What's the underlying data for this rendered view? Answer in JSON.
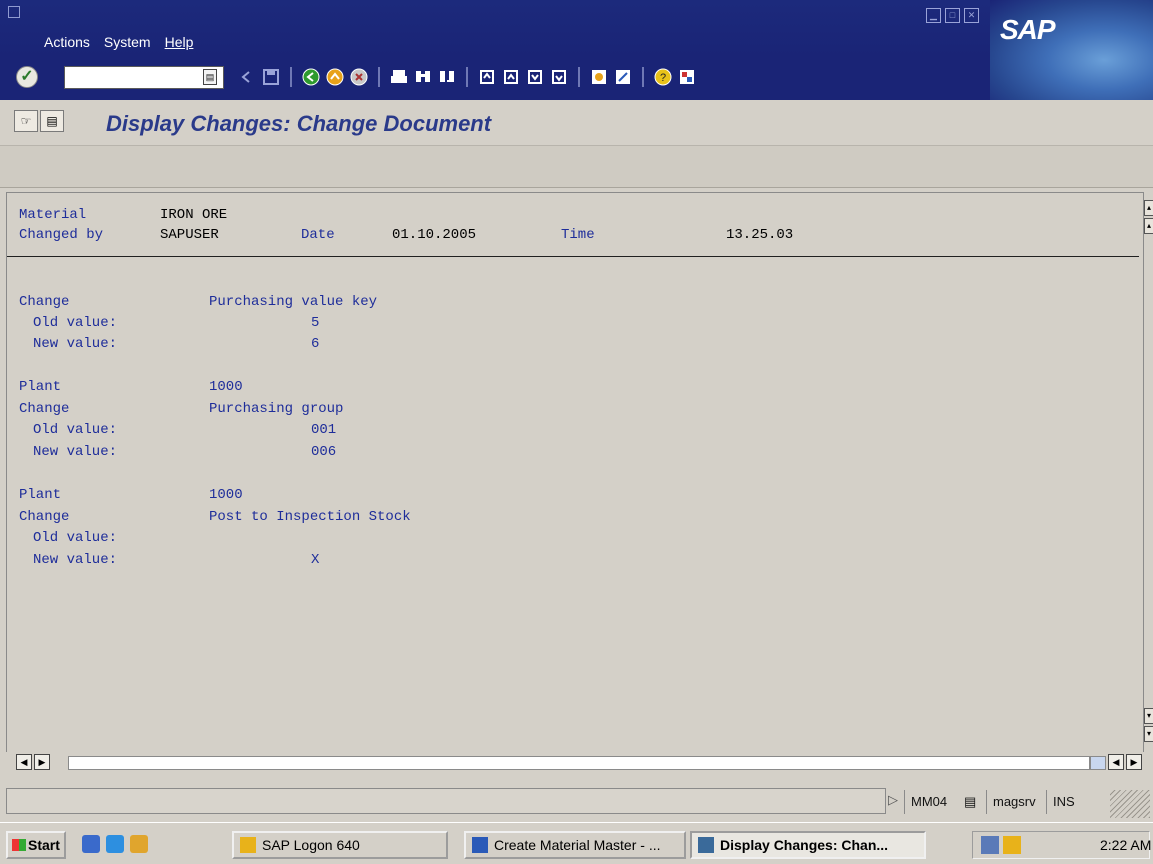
{
  "menu": {
    "actions": "Actions",
    "system": "System",
    "help": "Help"
  },
  "brand": {
    "logo_text": "SAP"
  },
  "toolbar": {
    "command_value": ""
  },
  "page": {
    "title": "Display Changes: Change Document"
  },
  "header": {
    "material_label": "Material",
    "material_value": "IRON ORE",
    "changed_by_label": "Changed by",
    "changed_by_value": "SAPUSER",
    "date_label": "Date",
    "date_value": "01.10.2005",
    "time_label": "Time",
    "time_value": "13.25.03"
  },
  "changes": [
    {
      "plant_label": "",
      "plant_value": "",
      "change_label": "Change",
      "field": "Purchasing value key",
      "old_label": "Old value:",
      "old_value": "5",
      "new_label": "New value:",
      "new_value": "6"
    },
    {
      "plant_label": "Plant",
      "plant_value": "1000",
      "change_label": "Change",
      "field": "Purchasing group",
      "old_label": "Old value:",
      "old_value": "001",
      "new_label": "New value:",
      "new_value": "006"
    },
    {
      "plant_label": "Plant",
      "plant_value": "1000",
      "change_label": "Change",
      "field": "Post to Inspection Stock",
      "old_label": "Old value:",
      "old_value": "",
      "new_label": "New value:",
      "new_value": "X"
    }
  ],
  "status": {
    "transaction": "MM04",
    "server": "magsrv",
    "mode": "INS"
  },
  "taskbar": {
    "start": "Start",
    "tasks": [
      "SAP Logon 640",
      "Create Material Master - ...",
      "Display Changes: Chan..."
    ],
    "clock": "2:22 AM"
  },
  "colors": {
    "frame_blue": "#1a2476",
    "label_blue": "#1e2d9a",
    "title_blue": "#2a3a8a",
    "background": "#d4d0c8"
  }
}
